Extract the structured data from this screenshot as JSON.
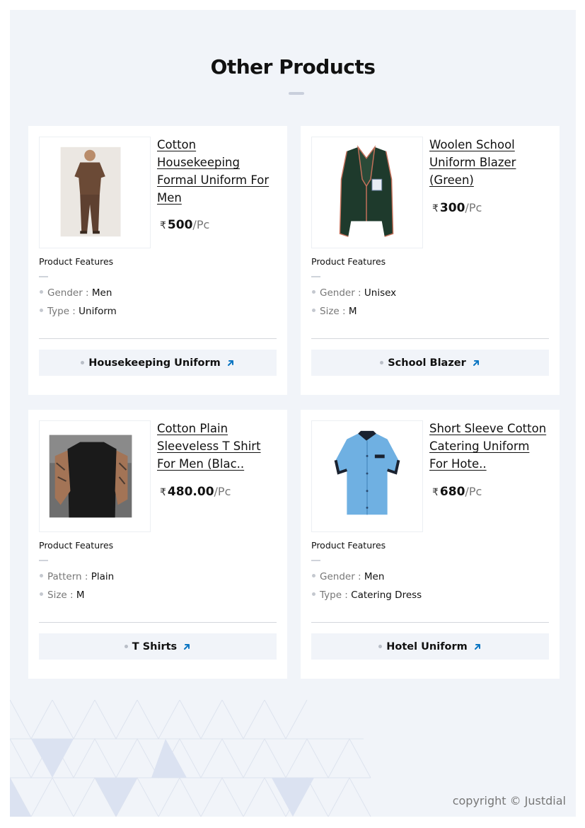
{
  "section_title": "Other Products",
  "products": [
    {
      "name": "Cotton Housekeeping Formal Uniform For Men",
      "currency": "₹",
      "price": "500",
      "unit": "/Pc",
      "features_label": "Product Features",
      "features": [
        {
          "label": "Gender :",
          "value": "Men"
        },
        {
          "label": "Type :",
          "value": "Uniform"
        }
      ],
      "category": "Housekeeping Uniform"
    },
    {
      "name": "Woolen School Uniform Blazer (Green)",
      "currency": "₹",
      "price": "300",
      "unit": "/Pc",
      "features_label": "Product Features",
      "features": [
        {
          "label": "Gender :",
          "value": "Unisex"
        },
        {
          "label": "Size :",
          "value": "M"
        }
      ],
      "category": "School Blazer"
    },
    {
      "name": "Cotton Plain Sleeveless T Shirt For Men (Blac..",
      "currency": "₹",
      "price": "480.00",
      "unit": "/Pc",
      "features_label": "Product Features",
      "features": [
        {
          "label": "Pattern :",
          "value": "Plain"
        },
        {
          "label": "Size :",
          "value": "M"
        }
      ],
      "category": "T Shirts"
    },
    {
      "name": "Short Sleeve Cotton Catering Uniform For Hote..",
      "currency": "₹",
      "price": "680",
      "unit": "/Pc",
      "features_label": "Product Features",
      "features": [
        {
          "label": "Gender :",
          "value": "Men"
        },
        {
          "label": "Type :",
          "value": "Catering Dress"
        }
      ],
      "category": "Hotel Uniform"
    }
  ],
  "footer": {
    "copyright": "copyright © Justdial"
  },
  "colors": {
    "accent_arrow": "#0a75c2",
    "page_bg": "#f1f4f9",
    "card_bg": "#ffffff"
  },
  "icons": {
    "category_link": "arrow-up-right-icon"
  }
}
